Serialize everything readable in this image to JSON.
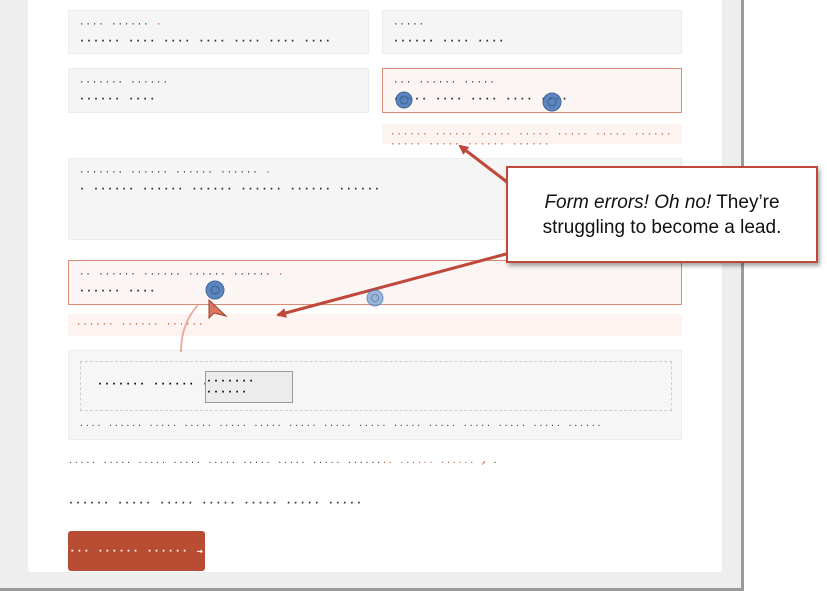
{
  "fields": {
    "row1_left": {
      "label": "···· ······",
      "required_mark": "·",
      "value": "······ ···· ···· ···· ···· ···· ····"
    },
    "row1_right": {
      "label": "·····",
      "value": "······ ···· ····"
    },
    "row2_left": {
      "label": "······· ······",
      "value": "······ ····"
    },
    "row2_right": {
      "label": "··· ······ ·····",
      "value": "····· ···· ···· ···· ····",
      "error": "······ ······ ····· ····· ····· ····· ······ ····· ····· ······ ······"
    },
    "textarea": {
      "label": "······· ······ ······ ······",
      "required_mark": "·",
      "value": "· ······ ······ ······ ······ ······ ······"
    },
    "row4": {
      "label": "·· ······ ······ ······ ······",
      "required_mark": "·",
      "value": "······ ····",
      "error": "······ ······ ······"
    }
  },
  "captcha": {
    "text": "······· ······ ······",
    "button": "······· ······",
    "note": "···· ······ ····· ····· ····· ····· ····· ····· ····· ····· ····· ····· ····· ····· ······"
  },
  "privacy": {
    "text": "····· ····· ····· ····· ····· ····· ····· ····· ······",
    "link": "·· ······ ······ ↗",
    "trail": "·"
  },
  "consent": "······ ····· ····· ····· ····· ····· ·····",
  "submit": {
    "label": "··· ······ ······",
    "arrow": "→"
  },
  "callout": {
    "part1": "Form errors! Oh no!",
    "part2": " They’re struggling to become a lead."
  },
  "colors": {
    "accent": "#b84d33",
    "error": "#c1502f",
    "callout_border": "#c0483a",
    "click_marker": "#3f72b5"
  },
  "icons": {
    "cursor": "cursor-icon",
    "submit_arrow": "arrow-right-icon"
  }
}
